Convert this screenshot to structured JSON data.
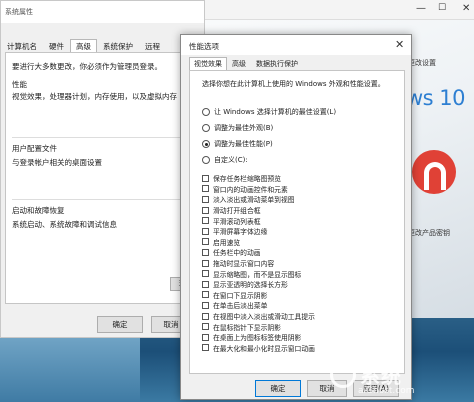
{
  "system_window": {
    "title": "系统",
    "min": "—",
    "max": "☐",
    "close": "✕"
  },
  "props_window": {
    "title": "系统属性",
    "tabs": [
      "计算机名",
      "硬件",
      "高级",
      "系统保护",
      "远程"
    ],
    "admin_note": "要进行大多数更改，你必须作为管理员登录。",
    "perf_title": "性能",
    "perf_desc": "视觉效果，处理器计划，内存使用，以及虚拟内存",
    "profile_title": "用户配置文件",
    "profile_desc": "与登录帐户相关的桌面设置",
    "startup_title": "启动和故障恢复",
    "startup_desc": "系统启动、系统故障和调试信息",
    "env_button": "环境",
    "ok": "确定",
    "cancel": "取消"
  },
  "right_side": {
    "win10": "ws 10",
    "lines": [
      "更改设置",
      "",
      "",
      "更改产品密钥"
    ]
  },
  "dialog": {
    "title": "性能选项",
    "close": "✕",
    "tabs": [
      "视觉效果",
      "高级",
      "数据执行保护"
    ],
    "description": "选择你想在此计算机上使用的 Windows 外观和性能设置。",
    "radios": [
      {
        "label": "让 Windows 选择计算机的最佳设置(L)",
        "selected": false
      },
      {
        "label": "调整为最佳外观(B)",
        "selected": false
      },
      {
        "label": "调整为最佳性能(P)",
        "selected": true
      },
      {
        "label": "自定义(C):",
        "selected": false
      }
    ],
    "checkboxes": [
      "保存任务栏缩略图预览",
      "窗口内的动画控件和元素",
      "淡入淡出或滑动菜单到视图",
      "滑动打开组合框",
      "平滑滚动列表框",
      "平滑屏幕字体边缘",
      "启用速览",
      "任务栏中的动画",
      "拖动时显示窗口内容",
      "显示缩略图，而不是显示图标",
      "显示亚透明的选择长方形",
      "在窗口下显示阴影",
      "在单击后淡出菜单",
      "在视图中淡入淡出或滑动工具提示",
      "在鼠标指针下显示阴影",
      "在桌面上为图标标签使用阴影",
      "在最大化和最小化时显示窗口动画"
    ],
    "ok": "确定",
    "cancel": "取消",
    "apply": "应用(A)"
  },
  "watermark": {
    "main": "系统",
    "sub": "aiGhost.com"
  },
  "colors": {
    "accent": "#0078d7",
    "win10_blue": "#2d7fd2",
    "brand_red": "#e04136"
  }
}
